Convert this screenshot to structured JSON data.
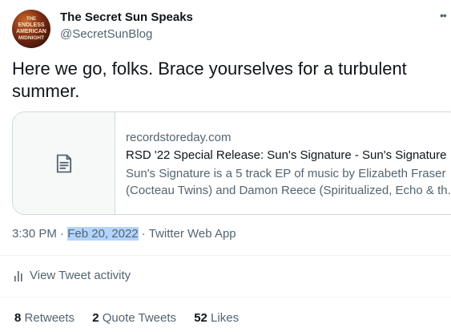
{
  "author": {
    "name": "The Secret Sun Speaks",
    "handle": "@SecretSunBlog",
    "avatar_text": [
      "THE",
      "ENDLESS",
      "AMERICAN",
      "MIDNIGHT"
    ]
  },
  "more_icon": "ellipsis-icon",
  "tweet": {
    "text": "Here we go, folks. Brace yourselves for a turbulent summer."
  },
  "card": {
    "thumb_icon": "document-icon",
    "domain": "recordstoreday.com",
    "title": "RSD '22 Special Release: Sun's Signature - Sun's Signature",
    "desc_line1": "Sun's Signature is a 5 track EP of music by Elizabeth Fraser",
    "desc_line2": "(Cocteau Twins) and Damon Reece (Spiritualized, Echo & th..."
  },
  "meta": {
    "time": "3:30 PM",
    "sep1": " · ",
    "date": "Feb 20, 2022",
    "sep2": " · ",
    "source": "Twitter Web App"
  },
  "activity": {
    "icon": "bar-chart-icon",
    "label": "View Tweet activity"
  },
  "stats": {
    "retweets_count": "8",
    "retweets_label": "Retweets",
    "quotes_count": "2",
    "quotes_label": "Quote Tweets",
    "likes_count": "52",
    "likes_label": "Likes"
  },
  "colors": {
    "text_primary": "#0f1419",
    "text_secondary": "#536471",
    "border": "#cfd9de",
    "selection": "#b3d4fc"
  }
}
